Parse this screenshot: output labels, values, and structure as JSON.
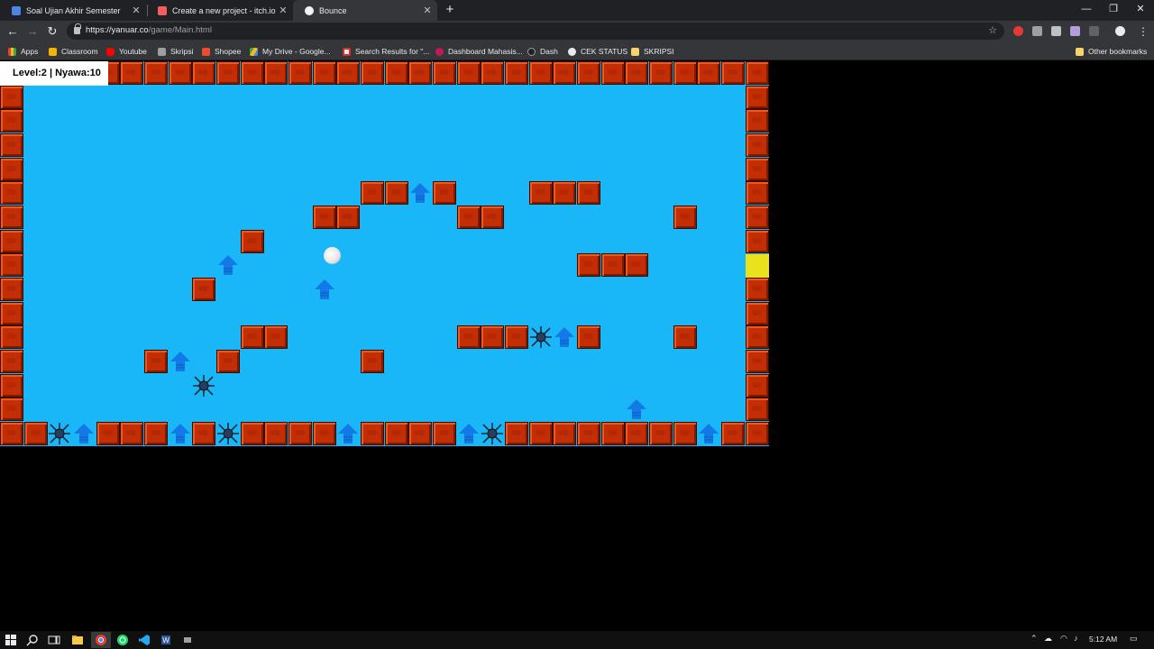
{
  "browser": {
    "tabs": [
      {
        "title": "Soal Ujian Akhir Semester",
        "active": false
      },
      {
        "title": "Create a new project - itch.io",
        "active": false
      },
      {
        "title": "Bounce",
        "active": true
      }
    ],
    "new_tab_label": "+",
    "window_buttons": {
      "minimize": "—",
      "restore": "❐",
      "close": "✕"
    },
    "nav": {
      "back": "←",
      "forward": "→",
      "reload": "↻"
    },
    "url": {
      "scheme": "https://",
      "host": "yanuar.co",
      "path": "/game/Main.html"
    },
    "bookmarks": [
      {
        "label": "Apps"
      },
      {
        "label": "Classroom"
      },
      {
        "label": "Youtube"
      },
      {
        "label": "Skripsi"
      },
      {
        "label": "Shopee"
      },
      {
        "label": "My Drive - Google..."
      },
      {
        "label": "Search Results for \"..."
      },
      {
        "label": "Dashboard Mahasis..."
      },
      {
        "label": "Dash"
      },
      {
        "label": "CEK STATUS"
      },
      {
        "label": "SKRIPSI"
      }
    ],
    "other_bookmarks": "Other bookmarks"
  },
  "game": {
    "hud": "Level:2 | Nyawa:10",
    "colors": {
      "sky": "#19b7f8",
      "brick": "#c42e05",
      "exit": "#e9e21d",
      "booster": "#1479e8",
      "ball": "#f2f2f2"
    }
  },
  "taskbar": {
    "clock": "5:12 AM"
  }
}
